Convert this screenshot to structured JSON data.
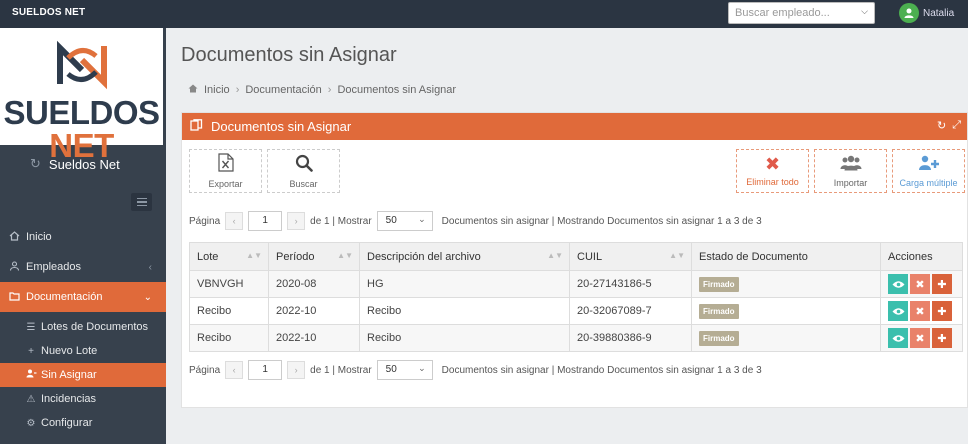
{
  "topbar": {
    "brand": "SUELDOS NET",
    "search_placeholder": "Buscar empleado...",
    "user_name": "Natalia"
  },
  "sidebar": {
    "logo_part1": "SUELDOS ",
    "logo_part2": "NET",
    "title": "Sueldos Net",
    "items": [
      {
        "label": "Inicio",
        "icon": "home-icon"
      },
      {
        "label": "Empleados",
        "icon": "users-icon"
      },
      {
        "label": "Documentación",
        "icon": "folder-icon"
      }
    ],
    "subitems": [
      {
        "label": "Lotes de Documentos",
        "icon": "list-icon"
      },
      {
        "label": "Nuevo Lote",
        "icon": "plus-icon"
      },
      {
        "label": "Sin Asignar",
        "icon": "user-unassigned-icon"
      },
      {
        "label": "Incidencias",
        "icon": "warning-icon"
      },
      {
        "label": "Configurar",
        "icon": "cogs-icon"
      }
    ]
  },
  "main": {
    "page_title": "Documentos sin Asignar",
    "breadcrumb": [
      "Inicio",
      "Documentación",
      "Documentos sin Asignar"
    ],
    "panel_title": "Documentos sin Asignar",
    "toolbar": {
      "export": "Exportar",
      "search": "Buscar",
      "delete_all": "Eliminar todo",
      "import": "Importar",
      "bulk_upload": "Carga múltiple"
    },
    "pager": {
      "page_label": "Página",
      "page": "1",
      "of_label": "de 1 | Mostrar",
      "page_size": "50",
      "summary": "Documentos sin asignar | Mostrando Documentos sin asignar 1 a 3 de 3"
    },
    "table": {
      "columns": [
        "Lote",
        "Período",
        "Descripción del archivo",
        "CUIL",
        "Estado de Documento",
        "Acciones"
      ],
      "rows": [
        {
          "lote": "VBNVGH",
          "periodo": "2020-08",
          "descripcion": "HG",
          "cuil": "20-27143186-5",
          "estado": "Firmado"
        },
        {
          "lote": "Recibo",
          "periodo": "2022-10",
          "descripcion": "Recibo",
          "cuil": "20-32067089-7",
          "estado": "Firmado"
        },
        {
          "lote": "Recibo",
          "periodo": "2022-10",
          "descripcion": "Recibo",
          "cuil": "20-39880386-9",
          "estado": "Firmado"
        }
      ]
    }
  },
  "colors": {
    "accent": "#e06a3a",
    "sidebar": "#37414d",
    "topbar": "#2b3542",
    "teal": "#3bbfad",
    "badge": "#b5ad94"
  }
}
